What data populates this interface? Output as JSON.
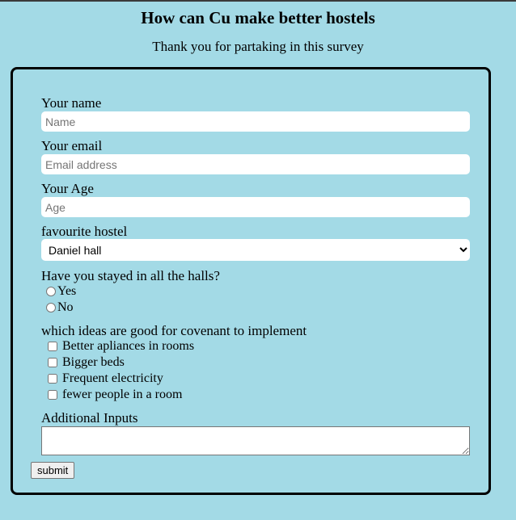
{
  "header": {
    "title": "How can Cu make better hostels",
    "subtitle": "Thank you for partaking in this survey"
  },
  "form": {
    "name_label": "Your name",
    "name_placeholder": "Name",
    "email_label": "Your email",
    "email_placeholder": "Email address",
    "age_label": "Your Age",
    "age_placeholder": "Age",
    "hostel_label": "favourite hostel",
    "hostel_selected": "Daniel hall",
    "stayed_label": "Have you stayed in all the halls?",
    "stayed_options": [
      "Yes",
      "No"
    ],
    "ideas_label": "which ideas are good for covenant to implement",
    "ideas_options": [
      "Better apliances in rooms",
      "Bigger beds",
      "Frequent electricity",
      "fewer people in a room"
    ],
    "additional_label": "Additional Inputs",
    "submit_label": "submit"
  },
  "colors": {
    "background": "#a3dae6",
    "border": "#000000"
  }
}
